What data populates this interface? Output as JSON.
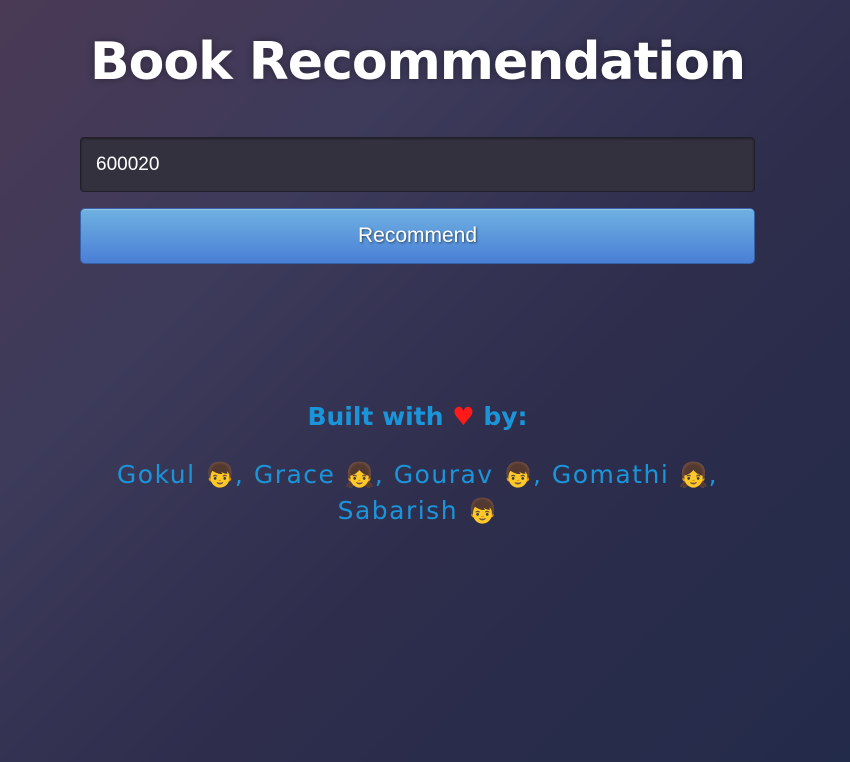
{
  "header": {
    "title": "Book Recommendation"
  },
  "search": {
    "value": "600020",
    "placeholder": ""
  },
  "actions": {
    "recommend_label": "Recommend"
  },
  "credits": {
    "prefix": "Built with",
    "heart": "♥",
    "suffix": "by:",
    "authors": [
      {
        "name": "Gokul",
        "emoji": "👦",
        "sep": ","
      },
      {
        "name": "Grace",
        "emoji": "👧",
        "sep": ","
      },
      {
        "name": "Gourav",
        "emoji": "👦",
        "sep": ","
      },
      {
        "name": "Gomathi",
        "emoji": "👧",
        "sep": ","
      },
      {
        "name": "Sabarish",
        "emoji": "👦",
        "sep": ""
      }
    ]
  },
  "colors": {
    "accent": "#1b95d9",
    "heart": "#ff1a1a",
    "button_top": "#6eb1e1",
    "button_bottom": "#4a7fd6"
  }
}
